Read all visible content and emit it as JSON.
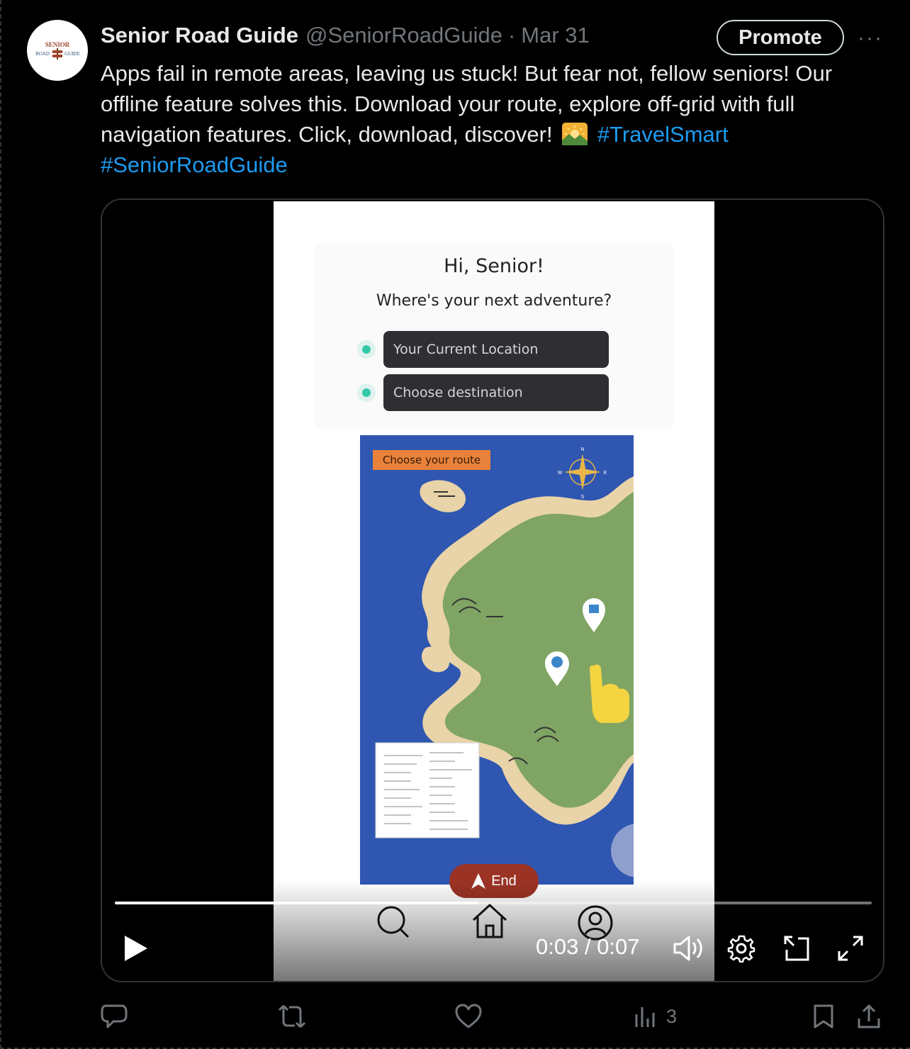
{
  "tweet": {
    "avatar_text_top": "SENIOR",
    "avatar_text_bottom_left": "ROAD",
    "avatar_text_bottom_right": "GUIDE",
    "display_name": "Senior Road Guide",
    "handle": "@SeniorRoadGuide",
    "separator": "·",
    "date": "Mar 31",
    "promote_label": "Promote",
    "more_label": "···",
    "text_part1": "Apps fail in remote areas, leaving us stuck! But fear not, fellow seniors! Our offline feature solves this. Download your route, explore off-grid with full navigation features. Click, download, discover!",
    "emoji_name": "sunrise-over-mountains-icon",
    "hashtag1": "#TravelSmart",
    "hashtag2": "#SeniorRoadGuide"
  },
  "video": {
    "greeting": "Hi, Senior!",
    "question": "Where's your next adventure?",
    "current_location_placeholder": "Your Current Location",
    "destination_placeholder": "Choose destination",
    "route_label": "Choose your route",
    "end_label": "End",
    "compass": {
      "n": "N",
      "s": "S",
      "e": "E",
      "w": "W"
    },
    "current_time": "0:03",
    "time_separator": " / ",
    "total_time": "0:07",
    "progress_fraction": 0.48
  },
  "actions": {
    "views_count": "3"
  },
  "colors": {
    "hashtag": "#1d9bf0",
    "muted": "#71767b",
    "water": "#2f56b0",
    "land": "#7fa463",
    "sand": "#e9d3a8",
    "route_label_bg": "#e8823a",
    "end_button_bg": "#9b3325"
  }
}
